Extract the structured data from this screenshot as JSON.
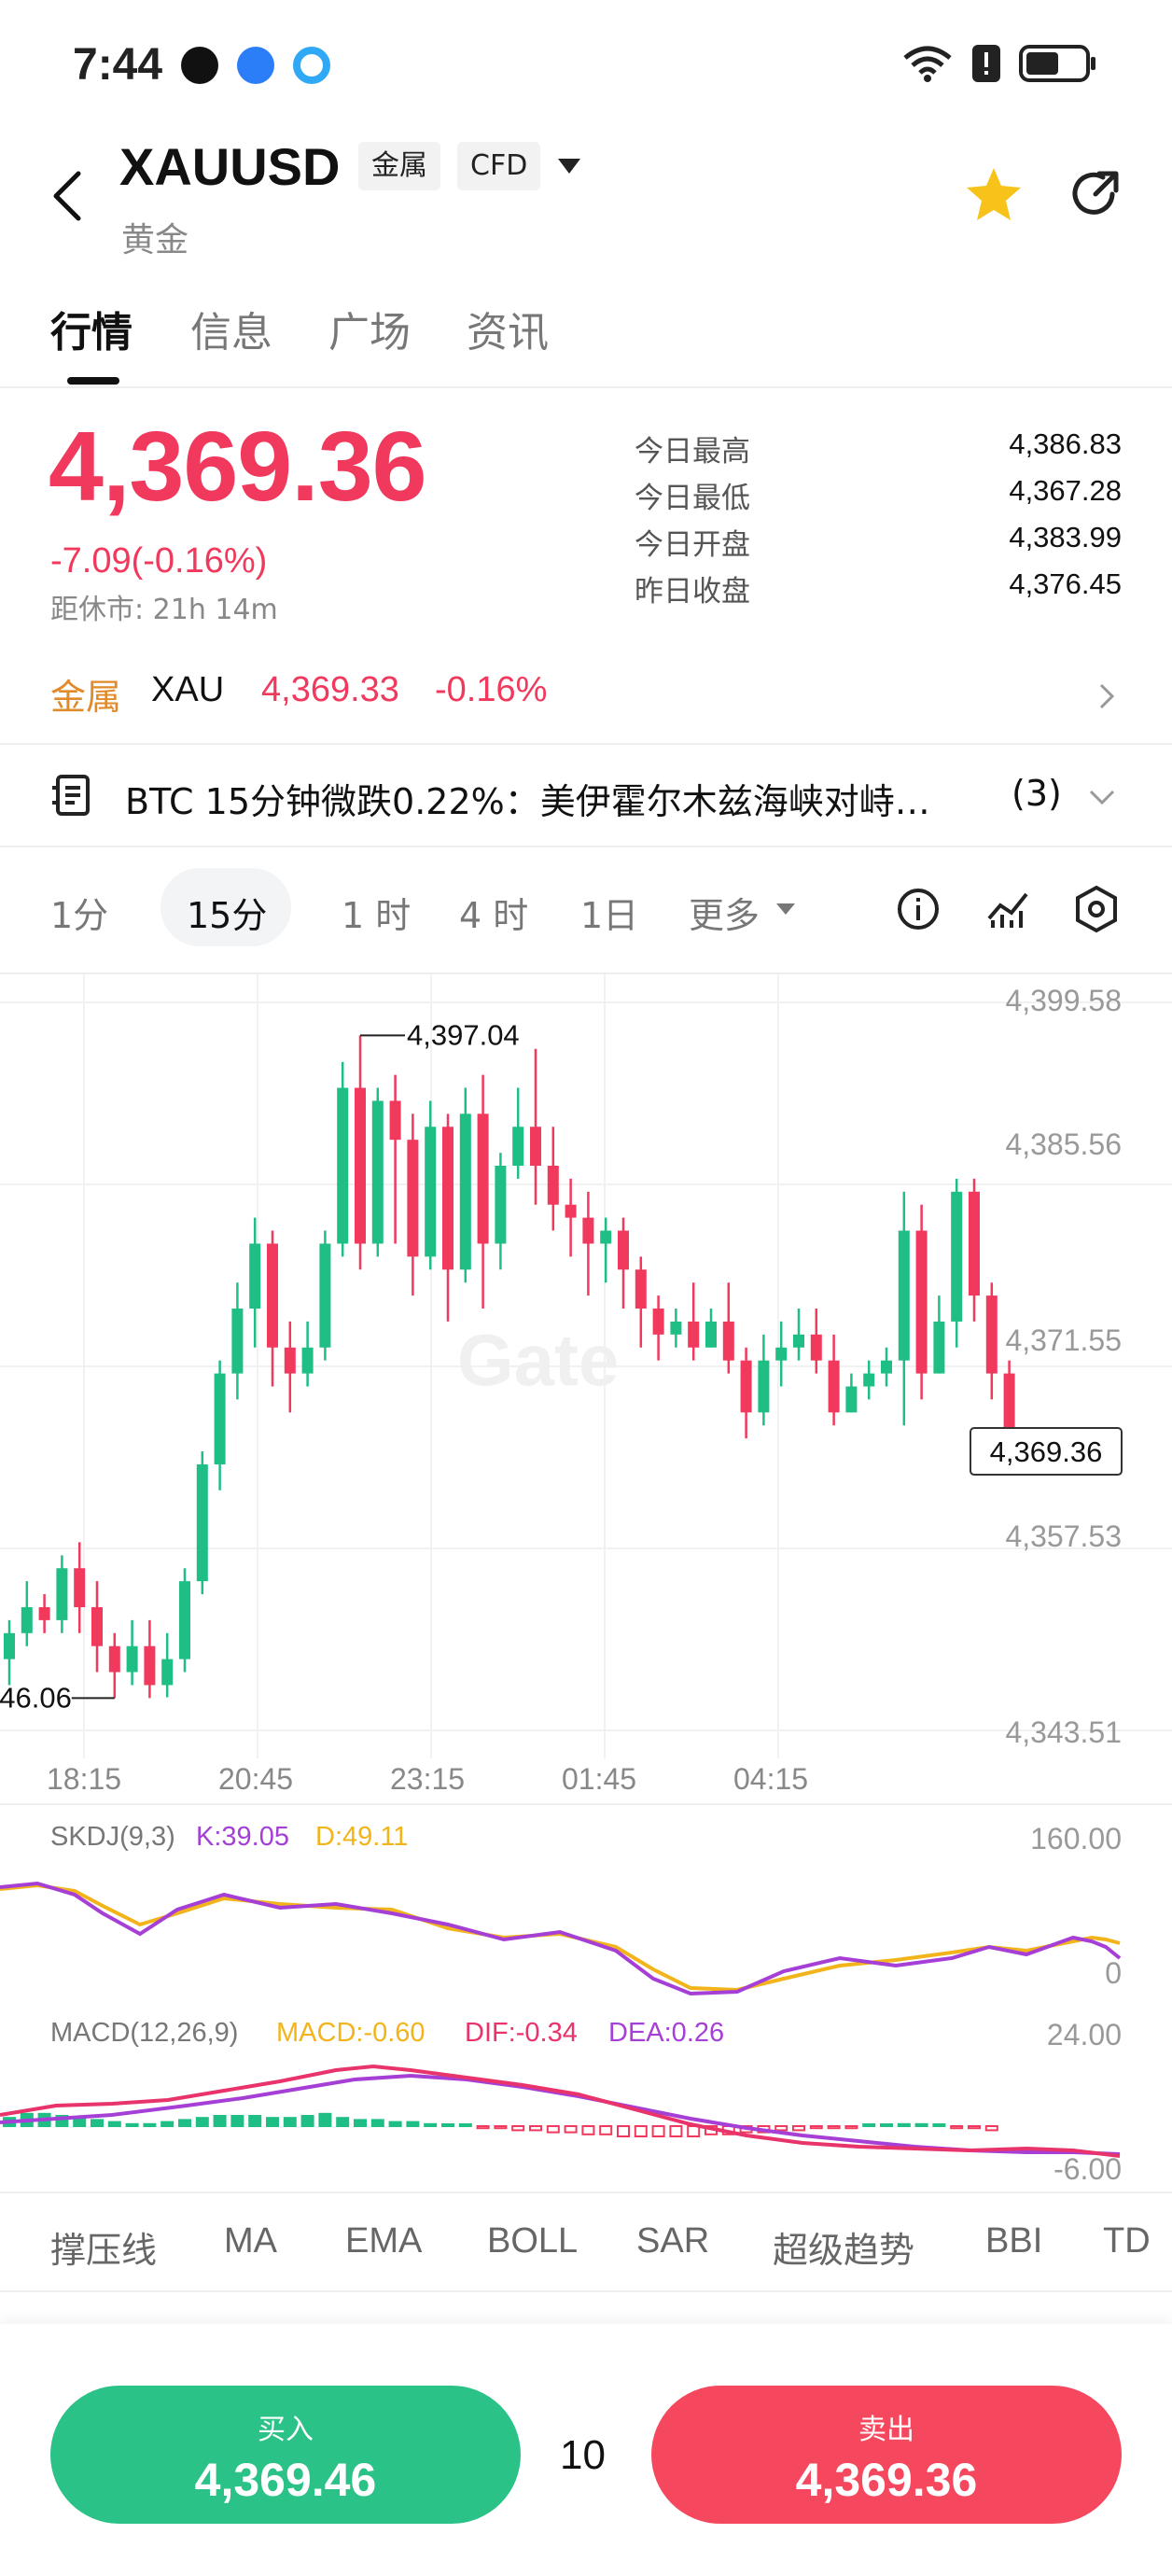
{
  "status": {
    "time": "7:44"
  },
  "header": {
    "symbol": "XAUUSD",
    "tag_metal": "金属",
    "tag_cfd": "CFD",
    "name": "黄金"
  },
  "tabs": [
    "行情",
    "信息",
    "广场",
    "资讯"
  ],
  "quote": {
    "price": "4,369.36",
    "change": "-7.09(-0.16%)",
    "close_in": "距休市: 21h 14m",
    "stats": [
      {
        "label": "今日最高",
        "value": "4,386.83"
      },
      {
        "label": "今日最低",
        "value": "4,367.28"
      },
      {
        "label": "今日开盘",
        "value": "4,383.99"
      },
      {
        "label": "昨日收盘",
        "value": "4,376.45"
      }
    ]
  },
  "metal_row": {
    "label": "金属",
    "symbol": "XAU",
    "price": "4,369.33",
    "pct": "-0.16%"
  },
  "news": {
    "text": "BTC 15分钟微跌0.22%：美伊霍尔木兹海峡对峙…",
    "count": "(3)"
  },
  "intervals": [
    "1分",
    "15分",
    "1 时",
    "4 时",
    "1日",
    "更多"
  ],
  "colors": {
    "up": "#1fbe85",
    "down": "#f0395c",
    "accent_orange": "#e08a2a"
  },
  "chart_data": {
    "type": "candlestick",
    "y_ticks": [
      "4,399.58",
      "4,385.56",
      "4,371.55",
      "4,357.53",
      "4,343.51"
    ],
    "x_ticks": [
      "18:15",
      "20:45",
      "23:15",
      "01:45",
      "04:15"
    ],
    "high_label": "4,397.04",
    "low_label": "4,346.06",
    "last_label": "4,369.36",
    "watermark": "Gate",
    "candles": [
      [
        4349,
        4351,
        4347,
        4352
      ],
      [
        4351,
        4353,
        4350,
        4355
      ],
      [
        4353,
        4352,
        4351,
        4354
      ],
      [
        4352,
        4356,
        4351,
        4357
      ],
      [
        4356,
        4353,
        4351,
        4358
      ],
      [
        4353,
        4350,
        4348,
        4355
      ],
      [
        4350,
        4348,
        4346,
        4351
      ],
      [
        4348,
        4350,
        4347,
        4352
      ],
      [
        4350,
        4347,
        4346,
        4352
      ],
      [
        4347,
        4349,
        4346.06,
        4351
      ],
      [
        4349,
        4355,
        4348,
        4356
      ],
      [
        4355,
        4364,
        4354,
        4365
      ],
      [
        4364,
        4371,
        4362,
        4372
      ],
      [
        4371,
        4376,
        4369,
        4378
      ],
      [
        4376,
        4381,
        4373,
        4383
      ],
      [
        4381,
        4373,
        4370,
        4382
      ],
      [
        4373,
        4371,
        4368,
        4375
      ],
      [
        4371,
        4373,
        4370,
        4375
      ],
      [
        4373,
        4381,
        4372,
        4382
      ],
      [
        4381,
        4393,
        4380,
        4395
      ],
      [
        4393,
        4381,
        4379,
        4397.04
      ],
      [
        4381,
        4392,
        4380,
        4393
      ],
      [
        4392,
        4389,
        4381,
        4394
      ],
      [
        4389,
        4380,
        4377,
        4391
      ],
      [
        4380,
        4390,
        4379,
        4392
      ],
      [
        4390,
        4379,
        4375,
        4391
      ],
      [
        4379,
        4391,
        4378,
        4393
      ],
      [
        4391,
        4381,
        4376,
        4394
      ],
      [
        4381,
        4387,
        4379,
        4388
      ],
      [
        4387,
        4390,
        4386,
        4393
      ],
      [
        4390,
        4387,
        4384,
        4396
      ],
      [
        4387,
        4384,
        4382,
        4390
      ],
      [
        4384,
        4383,
        4380,
        4386
      ],
      [
        4383,
        4381,
        4377,
        4385
      ],
      [
        4381,
        4382,
        4378,
        4383
      ],
      [
        4382,
        4379,
        4376,
        4383
      ],
      [
        4379,
        4376,
        4373,
        4380
      ],
      [
        4376,
        4374,
        4372,
        4377
      ],
      [
        4374,
        4375,
        4373,
        4376
      ],
      [
        4375,
        4373,
        4372,
        4378
      ],
      [
        4373,
        4375,
        4373,
        4376
      ],
      [
        4375,
        4372,
        4371,
        4378
      ],
      [
        4372,
        4368,
        4366,
        4373
      ],
      [
        4368,
        4372,
        4367,
        4374
      ],
      [
        4372,
        4373,
        4370,
        4375
      ],
      [
        4373,
        4374,
        4372,
        4376
      ],
      [
        4374,
        4372,
        4371,
        4376
      ],
      [
        4372,
        4368,
        4367,
        4374
      ],
      [
        4368,
        4370,
        4368,
        4371
      ],
      [
        4370,
        4371,
        4369,
        4372
      ],
      [
        4371,
        4372,
        4370,
        4373
      ],
      [
        4372,
        4382,
        4367,
        4385
      ],
      [
        4382,
        4371,
        4369,
        4384
      ],
      [
        4371,
        4375,
        4371,
        4377
      ],
      [
        4375,
        4385,
        4373,
        4386
      ],
      [
        4385,
        4377,
        4375,
        4386
      ],
      [
        4377,
        4371,
        4369,
        4378
      ],
      [
        4371,
        4365,
        4364,
        4372
      ]
    ]
  },
  "skdj": {
    "name": "SKDJ(9,3)",
    "k": "K:39.05",
    "d": "D:49.11",
    "max": "160.00",
    "min": "0"
  },
  "macd": {
    "name": "MACD(12,26,9)",
    "macd": "MACD:-0.60",
    "dif": "DIF:-0.34",
    "dea": "DEA:0.26",
    "max": "24.00",
    "min": "-6.00"
  },
  "indicator_tabs": [
    "撑压线",
    "MA",
    "EMA",
    "BOLL",
    "SAR",
    "超级趋势",
    "BBI",
    "TD"
  ],
  "trade": {
    "buy_label": "买入",
    "buy_price": "4,369.46",
    "quantity": "10",
    "sell_label": "卖出",
    "sell_price": "4,369.36"
  }
}
